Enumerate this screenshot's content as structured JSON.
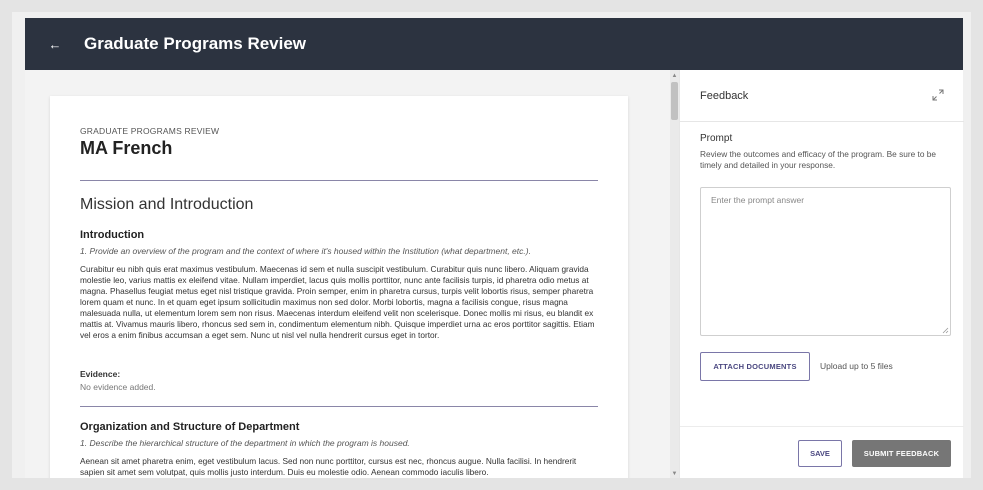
{
  "header": {
    "back_icon": "arrow-left-icon",
    "back_glyph": "←",
    "title": "Graduate Programs Review"
  },
  "document": {
    "kicker": "GRADUATE PROGRAMS REVIEW",
    "title": "MA French",
    "section_title": "Mission and Introduction",
    "subsections": [
      {
        "heading": "Introduction",
        "prompt": "1. Provide an overview of the program and the context of where it's housed within the Institution (what department, etc.).",
        "body": "Curabitur eu nibh quis erat maximus vestibulum. Maecenas id sem et nulla suscipit vestibulum. Curabitur quis nunc libero. Aliquam gravida molestie leo, varius mattis ex eleifend vitae. Nullam imperdiet, lacus quis mollis porttitor, nunc ante facilisis turpis, id pharetra odio metus at magna. Phasellus feugiat metus eget nisl tristique gravida. Proin semper, enim in pharetra cursus, turpis velit lobortis risus, semper pharetra lorem quam et nunc. In et quam eget ipsum sollicitudin maximus non sed dolor. Morbi lobortis, magna a facilisis congue, risus magna malesuada nulla, ut elementum lorem sem non risus. Maecenas interdum eleifend velit non scelerisque. Donec mollis mi risus, eu blandit ex mattis at. Vivamus mauris libero, rhoncus sed sem in, condimentum elementum nibh. Quisque imperdiet urna ac eros porttitor sagittis. Etiam vel eros a enim finibus accumsan a eget sem. Nunc ut nisl vel nulla hendrerit cursus eget in tortor.",
        "evidence_label": "Evidence:",
        "evidence_value": "No evidence added."
      },
      {
        "heading": "Organization and Structure of Department",
        "prompt": "1. Describe the hierarchical structure of the department in which the program is housed.",
        "body": "Aenean sit amet pharetra enim, eget vestibulum lacus. Sed non nunc porttitor, cursus est nec, rhoncus augue. Nulla facilisi. In hendrerit sapien sit amet sem volutpat, quis mollis justo interdum. Duis eu molestie odio. Aenean commodo iaculis libero."
      }
    ]
  },
  "feedback_panel": {
    "title": "Feedback",
    "expand_icon": "expand-icon",
    "prompt_label": "Prompt",
    "prompt_text": "Review the outcomes and efficacy of the program. Be sure to be timely and detailed in your response.",
    "input_value": "",
    "input_placeholder": "Enter the prompt answer",
    "attach_label": "ATTACH DOCUMENTS",
    "upload_hint": "Upload up to 5 files",
    "save_label": "SAVE",
    "submit_label": "SUBMIT FEEDBACK"
  },
  "colors": {
    "header_bg": "#2c3340",
    "accent": "#4a4780",
    "submit_bg": "#767676"
  }
}
